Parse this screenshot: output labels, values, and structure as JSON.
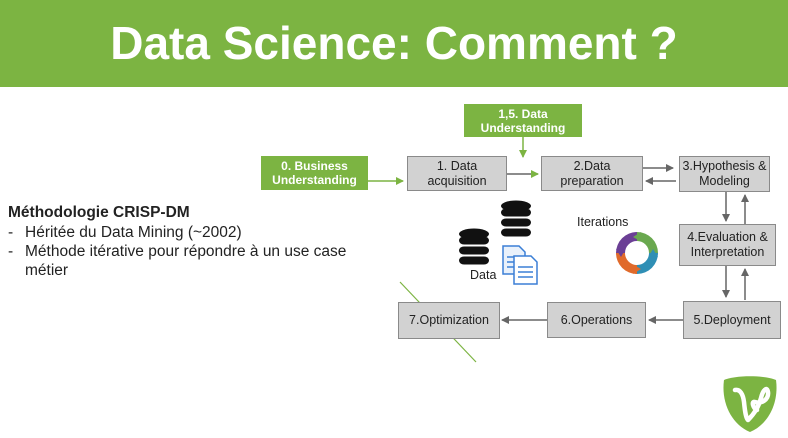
{
  "slide": {
    "title": "Data Science: Comment ?"
  },
  "methodology": {
    "heading": "Méthodologie CRISP-DM",
    "bullets": [
      "Héritée du Data Mining (~2002)",
      "Méthode itérative pour répondre à un use case métier"
    ]
  },
  "diagram": {
    "business_understanding": "0. Business Understanding",
    "data_understanding": "1,5. Data Understanding",
    "steps": {
      "acquisition": "1. Data acquisition",
      "preparation": "2.Data preparation",
      "hypothesis": "3.Hypothesis & Modeling",
      "evaluation": "4.Evaluation & Interpretation",
      "deployment": "5.Deployment",
      "operations": "6.Operations",
      "optimization": "7.Optimization"
    },
    "iterations_label": "Iterations",
    "data_label": "Data"
  },
  "colors": {
    "accent": "#7cb442",
    "box_fill": "#d2d2d2",
    "box_border": "#8a8a8a"
  },
  "icons": [
    "database-icon",
    "document-icon",
    "iteration-cycle-icon",
    "brand-logo-icon"
  ]
}
